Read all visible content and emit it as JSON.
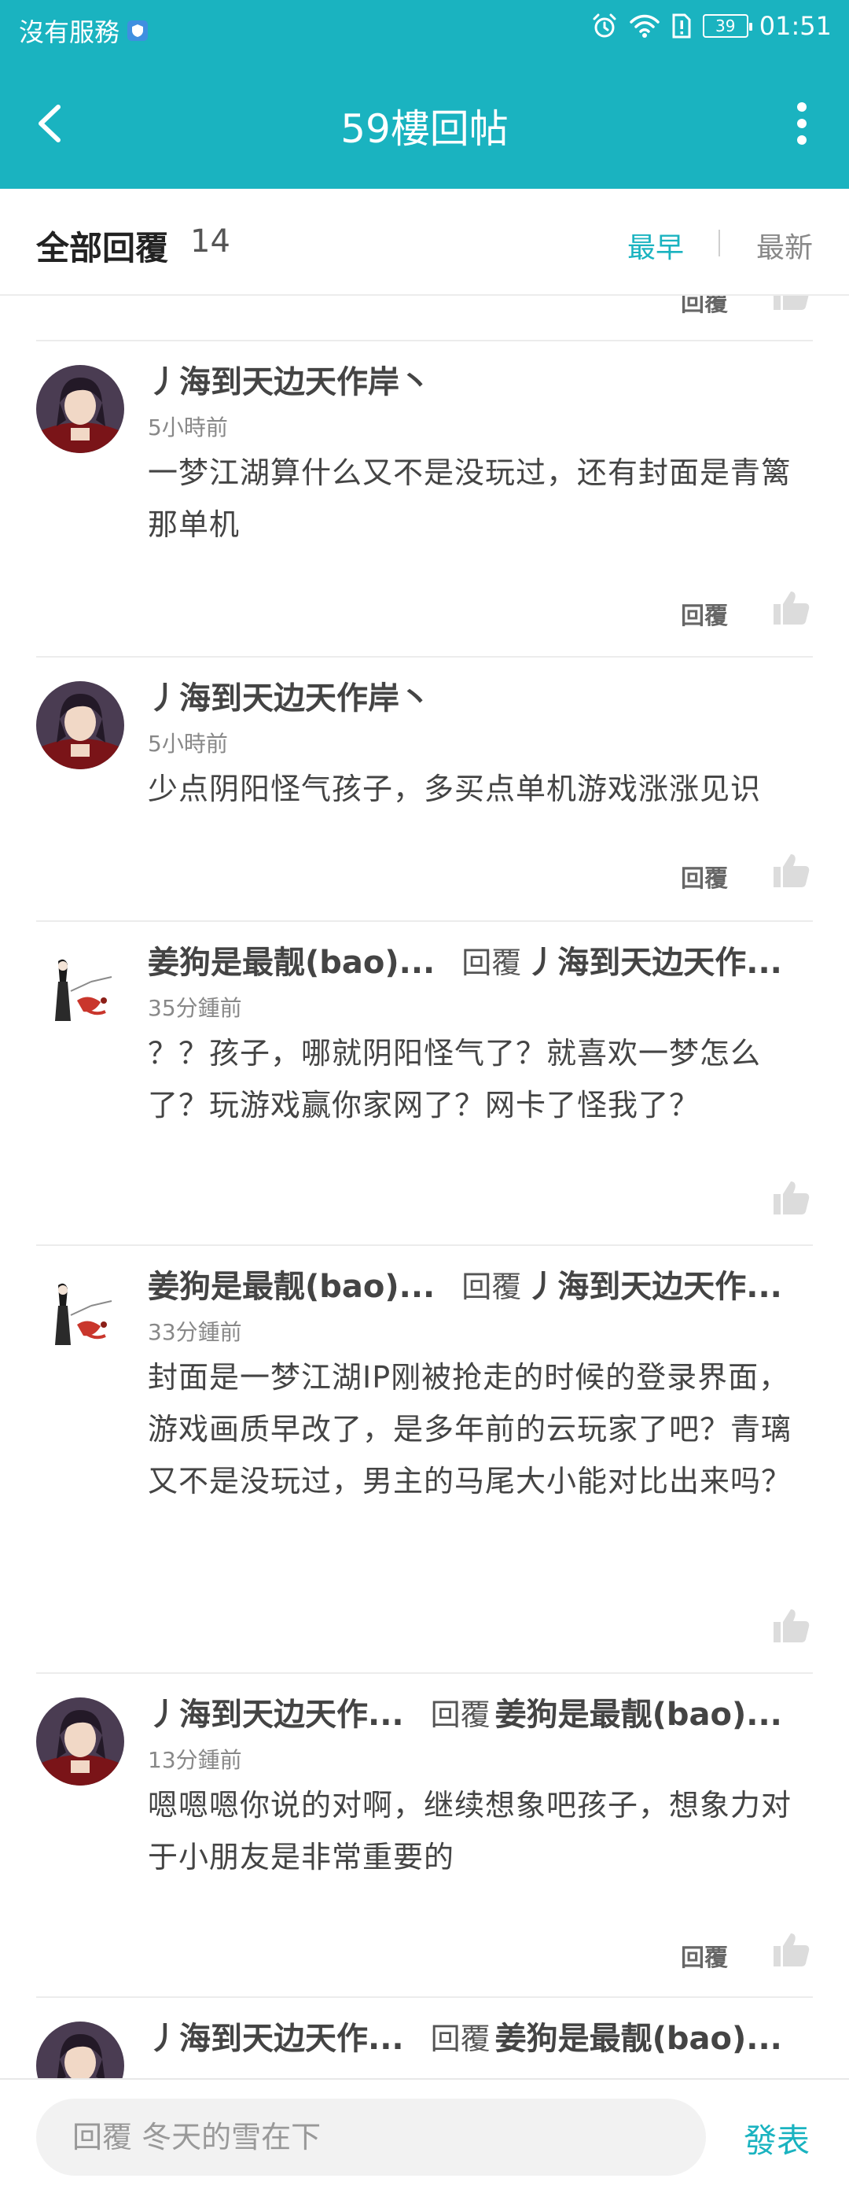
{
  "status_bar": {
    "carrier": "沒有服務",
    "battery": "39",
    "time": "01:51"
  },
  "nav": {
    "title": "59樓回帖"
  },
  "header": {
    "title": "全部回覆",
    "count": "14",
    "sort_earliest": "最早",
    "sort_latest": "最新"
  },
  "labels": {
    "reply": "回覆"
  },
  "comments": [
    {
      "author": "丿海到天边天作岸丶",
      "reply_to": "",
      "time": "5小時前",
      "text": "一梦江湖算什么又不是没玩过，还有封面是青篱那单机",
      "has_reply_btn": true
    },
    {
      "author": "丿海到天边天作岸丶",
      "reply_to": "",
      "time": "5小時前",
      "text": "少点阴阳怪气孩子，多买点单机游戏涨涨见识",
      "has_reply_btn": true
    },
    {
      "author": "姜狗是最靓(bao)...",
      "reply_to": "丿海到天边天作...",
      "time": "35分鍾前",
      "text": "？？孩子，哪就阴阳怪气了？就喜欢一梦怎么了？玩游戏赢你家网了？网卡了怪我了？",
      "has_reply_btn": false
    },
    {
      "author": "姜狗是最靓(bao)...",
      "reply_to": "丿海到天边天作...",
      "time": "33分鍾前",
      "text": "封面是一梦江湖IP刚被抢走的时候的登录界面，游戏画质早改了，是多年前的云玩家了吧？青璃又不是没玩过，男主的马尾大小能对比出来吗？",
      "has_reply_btn": false
    },
    {
      "author": "丿海到天边天作...",
      "reply_to": "姜狗是最靓(bao)...",
      "time": "13分鍾前",
      "text": "嗯嗯嗯你说的对啊，继续想象吧孩子，想象力对于小朋友是非常重要的",
      "has_reply_btn": true
    },
    {
      "author": "丿海到天边天作...",
      "reply_to": "姜狗是最靓(bao)...",
      "time": "",
      "text": "",
      "has_reply_btn": false
    }
  ],
  "composer": {
    "placeholder": "回覆 冬天的雪在下",
    "send_label": "發表"
  },
  "colors": {
    "accent": "#1ab3c0",
    "text": "#444444",
    "muted": "#888888",
    "divider": "#ececec"
  }
}
